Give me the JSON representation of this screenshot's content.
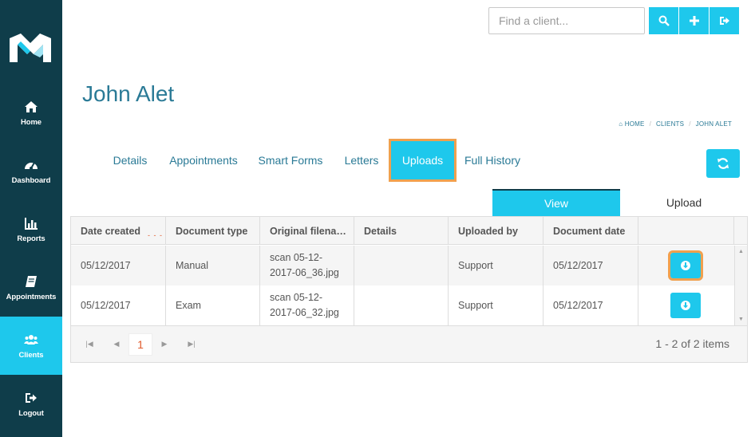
{
  "sidebar": {
    "items": [
      {
        "label": "Home",
        "icon": "home-icon"
      },
      {
        "label": "Dashboard",
        "icon": "dashboard-icon"
      },
      {
        "label": "Reports",
        "icon": "reports-icon"
      },
      {
        "label": "Appointments",
        "icon": "book-icon"
      },
      {
        "label": "Clients",
        "icon": "users-icon",
        "active": true
      },
      {
        "label": "Logout",
        "icon": "logout-icon"
      }
    ]
  },
  "search": {
    "placeholder": "Find a client..."
  },
  "page": {
    "title": "John Alet"
  },
  "breadcrumb": {
    "home": "HOME",
    "clients": "CLIENTS",
    "current": "JOHN ALET"
  },
  "tabs": [
    "Details",
    "Appointments",
    "Smart Forms",
    "Letters",
    "Uploads",
    "Full History"
  ],
  "active_tab": "Uploads",
  "segments": {
    "view": "View",
    "upload": "Upload"
  },
  "table": {
    "columns": [
      "Date created",
      "Document type",
      "Original filena…",
      "Details",
      "Uploaded by",
      "Document date"
    ],
    "rows": [
      {
        "date_created": "05/12/2017",
        "document_type": "Manual",
        "filename_1": "scan 05-12-",
        "filename_2": "2017-06_36.jpg",
        "details": "",
        "uploaded_by": "Support",
        "document_date": "05/12/2017"
      },
      {
        "date_created": "05/12/2017",
        "document_type": "Exam",
        "filename_1": "scan 05-12-",
        "filename_2": "2017-06_32.jpg",
        "details": "",
        "uploaded_by": "Support",
        "document_date": "05/12/2017"
      }
    ]
  },
  "pager": {
    "current_page": "1",
    "info": "1 - 2 of 2 items"
  },
  "colors": {
    "sidebar": "#0f3d4a",
    "accent": "#1ec8ec",
    "highlight": "#f0a04e",
    "title": "#2a7a96"
  }
}
